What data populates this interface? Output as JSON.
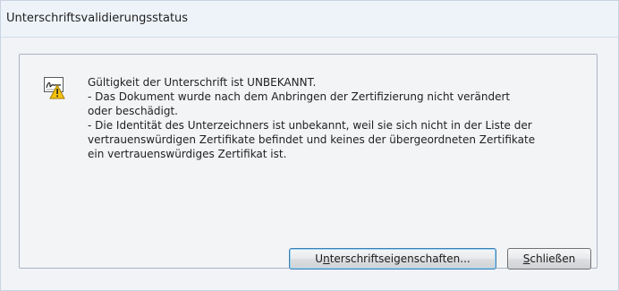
{
  "window": {
    "title": "Unterschriftsvalidierungsstatus"
  },
  "icon": {
    "name": "signature-warning-icon"
  },
  "message": {
    "lines": [
      "Gültigkeit der Unterschrift ist UNBEKANNT.",
      "- Das Dokument wurde nach dem Anbringen der Zertifizierung nicht verändert",
      "oder beschädigt.",
      "- Die Identität des Unterzeichners ist unbekannt, weil sie sich nicht in der Liste der",
      "vertrauenswürdigen Zertifikate befindet und keines der übergeordneten Zertifikate",
      "ein vertrauenswürdiges Zertifikat ist."
    ]
  },
  "buttons": {
    "properties": {
      "prefix": "U",
      "accel": "n",
      "rest": "terschriftseigenschaften..."
    },
    "close": {
      "prefix": "",
      "accel": "S",
      "rest": "chließen"
    }
  },
  "colors": {
    "dialog_bg": "#f3f6fb",
    "default_button_border": "#3c7fb1",
    "warning_yellow": "#f4c20d"
  }
}
